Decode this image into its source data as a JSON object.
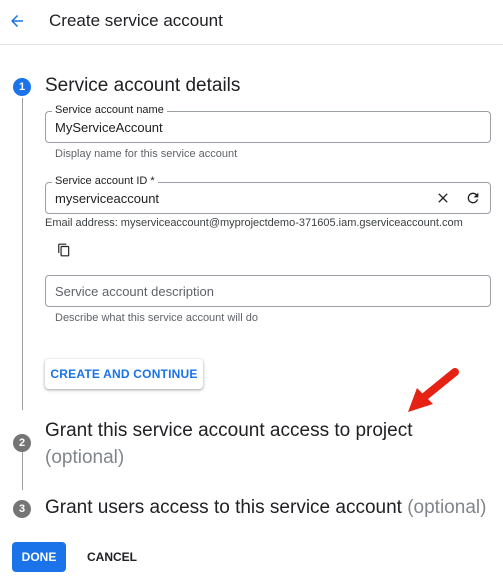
{
  "header": {
    "title": "Create service account"
  },
  "steps": [
    {
      "number": "1",
      "title": "Service account details"
    },
    {
      "number": "2",
      "title": "Grant this service account access to project",
      "optional": "(optional)"
    },
    {
      "number": "3",
      "title": "Grant users access to this service account",
      "optional": "(optional)"
    }
  ],
  "fields": {
    "name": {
      "label": "Service account name",
      "value": "MyServiceAccount",
      "hint": "Display name for this service account"
    },
    "id": {
      "label": "Service account ID *",
      "value": "myserviceaccount",
      "email": "Email address: myserviceaccount@myprojectdemo-371605.iam.gserviceaccount.com"
    },
    "description": {
      "placeholder": "Service account description",
      "hint": "Describe what this service account will do"
    }
  },
  "buttons": {
    "create_continue": "CREATE AND CONTINUE",
    "done": "DONE",
    "cancel": "CANCEL"
  },
  "icons": {
    "back": "arrow-back-icon",
    "clear": "close-icon",
    "refresh": "refresh-icon",
    "copy": "copy-icon",
    "annotation": "red-arrow-annotation-icon"
  },
  "colors": {
    "accent": "#1a73e8",
    "annotation": "#e52213",
    "step_inactive": "#757575"
  }
}
